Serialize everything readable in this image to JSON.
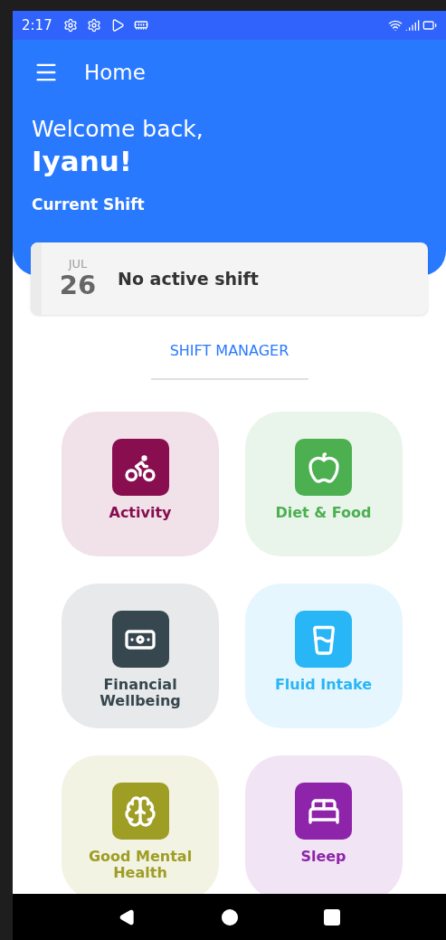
{
  "status_bar": {
    "time": "2:17"
  },
  "app_bar": {
    "title": "Home"
  },
  "welcome": {
    "greeting": "Welcome back,",
    "name": "Iyanu!"
  },
  "current_shift": {
    "heading": "Current Shift",
    "month": "JUL",
    "day": "26",
    "status": "No active shift"
  },
  "shift_manager_link": "SHIFT MANAGER",
  "tiles": [
    {
      "kind": "activity",
      "label": "Activity",
      "color": "#880e4f"
    },
    {
      "kind": "diet",
      "label": "Diet & Food",
      "color": "#4caf50"
    },
    {
      "kind": "finance",
      "label": "Financial Wellbeing",
      "color": "#37474f"
    },
    {
      "kind": "fluid",
      "label": "Fluid Intake",
      "color": "#29b6f6"
    },
    {
      "kind": "mental",
      "label": "Good Mental Health",
      "color": "#9e9d24"
    },
    {
      "kind": "sleep",
      "label": "Sleep",
      "color": "#8e24aa"
    }
  ]
}
